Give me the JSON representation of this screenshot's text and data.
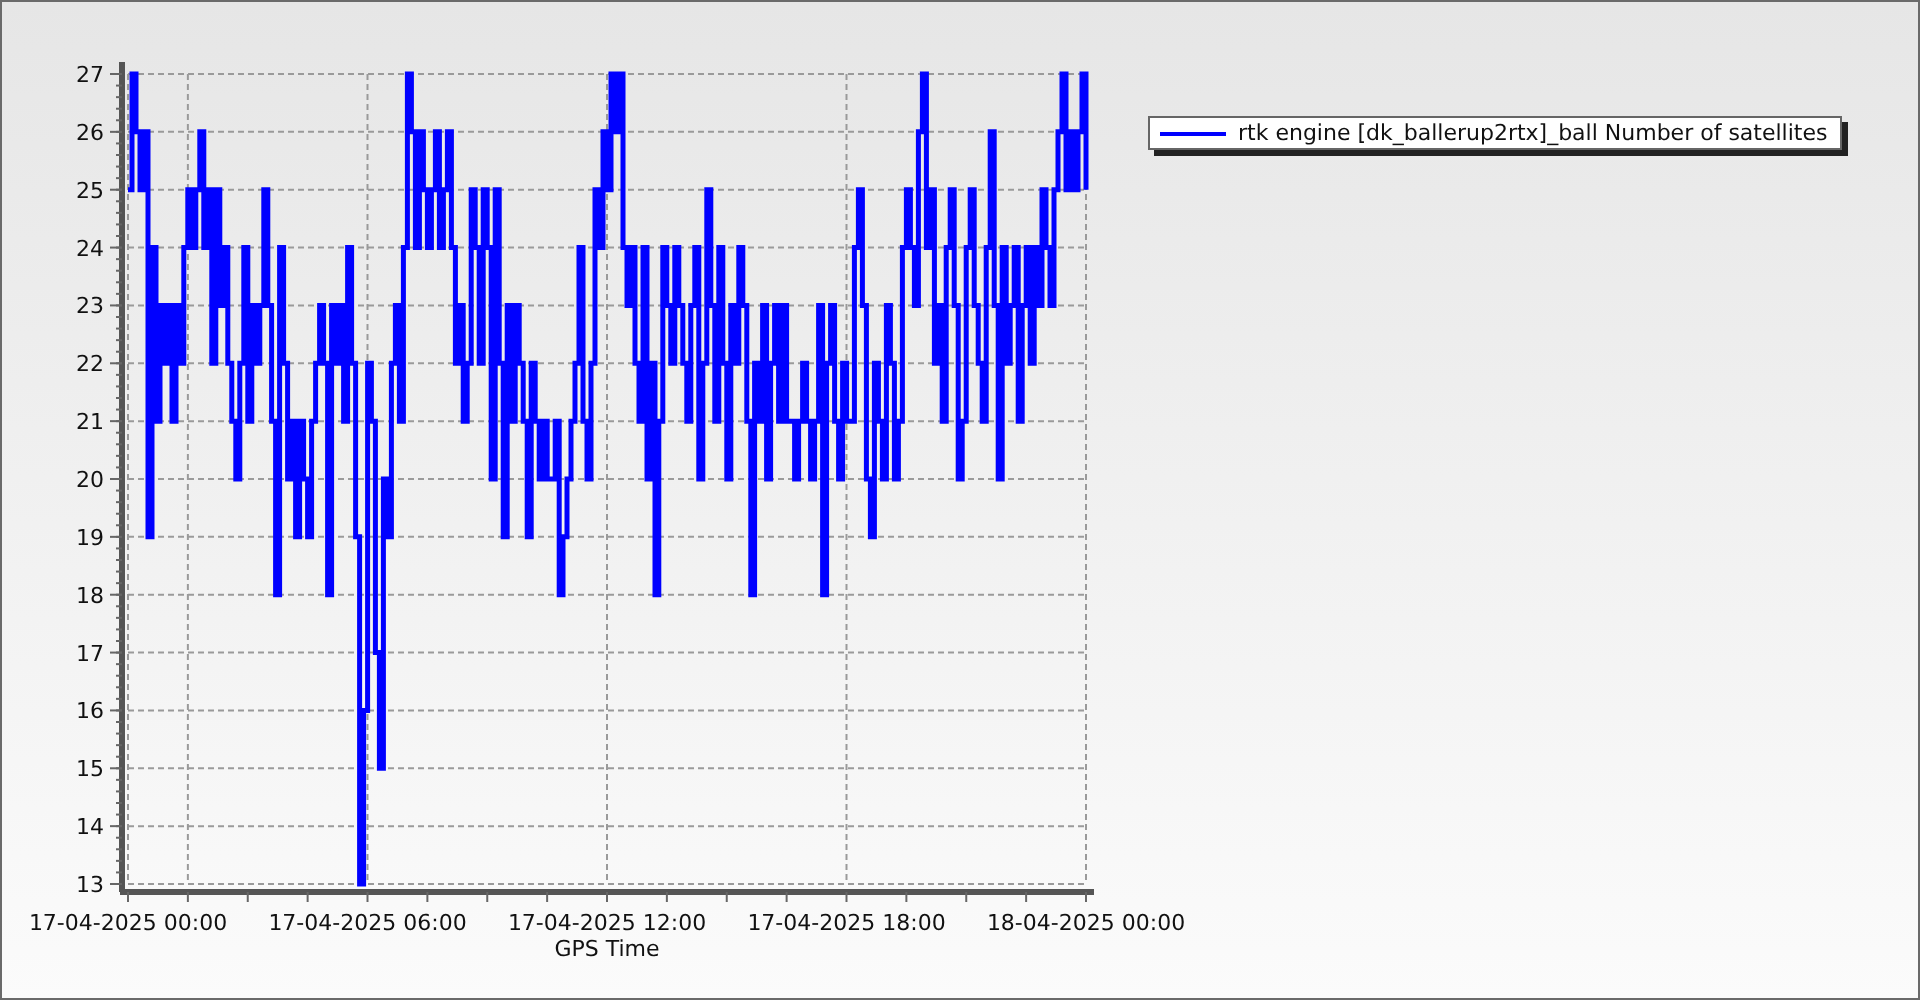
{
  "chart": {
    "chart_data": {
      "type": "line",
      "grid": true,
      "xlabel": "GPS Time",
      "ylim": [
        13,
        27
      ],
      "categories": [
        "17-04-2025 00:00",
        null,
        null,
        null,
        null,
        null,
        null,
        null,
        null,
        null,
        null,
        null,
        null,
        null,
        null,
        null,
        null,
        null,
        null,
        null,
        null,
        null,
        null,
        null,
        null,
        null,
        null,
        null,
        null,
        null,
        null,
        null,
        null,
        null,
        null,
        null,
        null,
        null,
        null,
        null,
        null,
        null,
        null,
        null,
        null,
        null,
        null,
        null,
        null,
        null,
        null,
        null,
        null,
        null,
        null,
        null,
        null,
        null,
        null,
        null,
        "17-04-2025 06:00",
        null,
        null,
        null,
        null,
        null,
        null,
        null,
        null,
        null,
        null,
        null,
        null,
        null,
        null,
        null,
        null,
        null,
        null,
        null,
        null,
        null,
        null,
        null,
        null,
        null,
        null,
        null,
        null,
        null,
        null,
        null,
        null,
        null,
        null,
        null,
        null,
        null,
        null,
        null,
        null,
        null,
        null,
        null,
        null,
        null,
        null,
        null,
        null,
        null,
        null,
        null,
        null,
        null,
        null,
        null,
        null,
        null,
        null,
        null,
        "17-04-2025 12:00",
        null,
        null,
        null,
        null,
        null,
        null,
        null,
        null,
        null,
        null,
        null,
        null,
        null,
        null,
        null,
        null,
        null,
        null,
        null,
        null,
        null,
        null,
        null,
        null,
        null,
        null,
        null,
        null,
        null,
        null,
        null,
        null,
        null,
        null,
        null,
        null,
        null,
        null,
        null,
        null,
        null,
        null,
        null,
        null,
        null,
        null,
        null,
        null,
        null,
        null,
        null,
        null,
        null,
        null,
        null,
        null,
        null,
        null,
        null,
        "17-04-2025 18:00",
        null,
        null,
        null,
        null,
        null,
        null,
        null,
        null,
        null,
        null,
        null,
        null,
        null,
        null,
        null,
        null,
        null,
        null,
        null,
        null,
        null,
        null,
        null,
        null,
        null,
        null,
        null,
        null,
        null,
        null,
        null,
        null,
        null,
        null,
        null,
        null,
        null,
        null,
        null,
        null,
        null,
        null,
        null,
        null,
        null,
        null,
        null,
        null,
        null,
        null,
        null,
        null,
        null,
        null,
        null,
        null,
        null,
        null,
        null,
        "18-04-2025 00:00"
      ],
      "yticks": [
        13,
        14,
        15,
        16,
        17,
        18,
        19,
        20,
        21,
        22,
        23,
        24,
        25,
        26,
        27
      ],
      "series": [
        {
          "name": "rtk engine [dk_ballerup2rtx]_ball Number of satellites",
          "color": "#0000ff",
          "values": [
            25,
            27,
            26,
            25,
            26,
            19,
            24,
            21,
            23,
            22,
            23,
            21,
            23,
            22,
            24,
            25,
            24,
            25,
            26,
            24,
            25,
            22,
            25,
            23,
            24,
            22,
            21,
            20,
            22,
            24,
            21,
            23,
            22,
            23,
            25,
            23,
            21,
            18,
            24,
            22,
            20,
            21,
            19,
            21,
            20,
            19,
            21,
            22,
            23,
            22,
            18,
            23,
            22,
            23,
            21,
            24,
            22,
            19,
            13,
            16,
            22,
            21,
            17,
            15,
            20,
            19,
            22,
            23,
            21,
            24,
            27,
            26,
            24,
            26,
            25,
            24,
            25,
            26,
            24,
            25,
            26,
            24,
            22,
            23,
            21,
            22,
            25,
            24,
            22,
            25,
            24,
            20,
            25,
            22,
            19,
            23,
            21,
            23,
            22,
            21,
            19,
            22,
            21,
            20,
            21,
            20,
            20,
            21,
            18,
            19,
            20,
            21,
            22,
            24,
            21,
            20,
            22,
            25,
            24,
            26,
            25,
            27,
            26,
            27,
            24,
            23,
            24,
            22,
            21,
            24,
            20,
            22,
            18,
            21,
            24,
            23,
            22,
            24,
            23,
            22,
            21,
            23,
            24,
            20,
            22,
            25,
            23,
            21,
            24,
            22,
            20,
            23,
            22,
            24,
            23,
            21,
            18,
            22,
            21,
            23,
            20,
            22,
            23,
            21,
            23,
            21,
            21,
            20,
            21,
            22,
            21,
            20,
            21,
            23,
            18,
            22,
            23,
            21,
            20,
            22,
            21,
            21,
            24,
            25,
            23,
            20,
            19,
            22,
            21,
            20,
            23,
            22,
            20,
            21,
            24,
            25,
            24,
            23,
            26,
            27,
            24,
            25,
            22,
            23,
            21,
            24,
            25,
            23,
            20,
            21,
            24,
            25,
            23,
            22,
            21,
            24,
            26,
            23,
            20,
            24,
            22,
            23,
            24,
            21,
            23,
            24,
            22,
            24,
            23,
            25,
            24,
            23,
            25,
            26,
            27,
            25,
            26,
            25,
            26,
            27,
            25
          ]
        }
      ]
    }
  }
}
